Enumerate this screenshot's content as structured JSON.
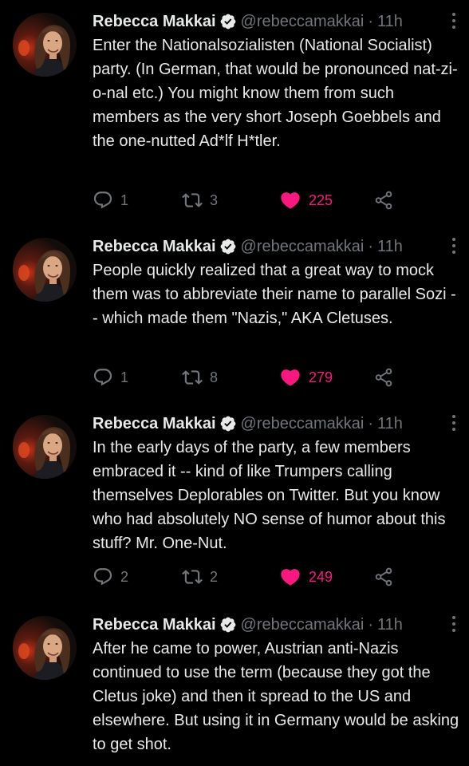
{
  "colors": {
    "background": "#000000",
    "text": "#e7e9ea",
    "muted": "#71767b",
    "like": "#f91880",
    "verified": "#e7e9ea"
  },
  "tweets": [
    {
      "name": "Rebecca Makkai",
      "handle": "@rebeccamakkai",
      "separator": "·",
      "time": "11h",
      "text": "Enter the Nationalsozialisten (National Socialist) party. (In German, that would be pronounced nat-zi-o-nal etc.) You might know them from such members as the very short Joseph Goebbels and the one-nutted Ad*lf H*tler.",
      "replies": "1",
      "retweets": "3",
      "likes": "225",
      "icons": [
        "verified-badge-icon",
        "more-options-icon",
        "reply-icon",
        "retweet-icon",
        "heart-filled-icon",
        "share-icon"
      ]
    },
    {
      "name": "Rebecca Makkai",
      "handle": "@rebeccamakkai",
      "separator": "·",
      "time": "11h",
      "text": "People quickly realized that a great way to mock them was to abbreviate their name to parallel Sozi -- which made them \"Nazis,\" AKA Cletuses.",
      "replies": "1",
      "retweets": "8",
      "likes": "279",
      "icons": [
        "verified-badge-icon",
        "more-options-icon",
        "reply-icon",
        "retweet-icon",
        "heart-filled-icon",
        "share-icon"
      ]
    },
    {
      "name": "Rebecca Makkai",
      "handle": "@rebeccamakkai",
      "separator": "·",
      "time": "11h",
      "text": "In the early days of the party, a few members embraced it -- kind of like Trumpers calling themselves Deplorables on Twitter. But you know who had absolutely NO sense of humor about this stuff? Mr. One-Nut.",
      "replies": "2",
      "retweets": "2",
      "likes": "249",
      "icons": [
        "verified-badge-icon",
        "more-options-icon",
        "reply-icon",
        "retweet-icon",
        "heart-filled-icon",
        "share-icon"
      ]
    },
    {
      "name": "Rebecca Makkai",
      "handle": "@rebeccamakkai",
      "separator": "·",
      "time": "11h",
      "text": "After he came to power, Austrian anti-Nazis continued to use the term (because they got the Cletus joke) and then it spread to the US and elsewhere. But using it in Germany would be asking to get shot.",
      "icons": [
        "verified-badge-icon",
        "more-options-icon"
      ]
    }
  ]
}
